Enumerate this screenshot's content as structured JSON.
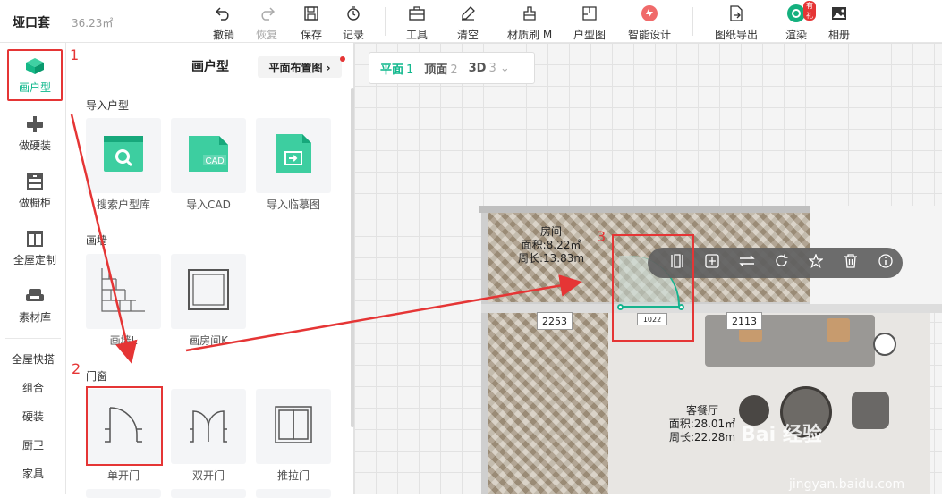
{
  "header": {
    "project_name": "垭口套",
    "project_area": "36.23㎡",
    "toolbar": [
      {
        "label": "撤销",
        "icon": "undo-icon"
      },
      {
        "label": "恢复",
        "icon": "redo-icon"
      },
      {
        "label": "保存",
        "icon": "save-icon"
      },
      {
        "label": "记录",
        "icon": "history-icon"
      },
      {
        "label": "工具",
        "icon": "toolbox-icon"
      },
      {
        "label": "清空",
        "icon": "eraser-icon"
      },
      {
        "label": "材质刷 M",
        "icon": "brush-icon"
      },
      {
        "label": "户型图",
        "icon": "floorplan-icon"
      },
      {
        "label": "智能设计",
        "icon": "ai-design-icon"
      },
      {
        "label": "图纸导出",
        "icon": "export-icon"
      },
      {
        "label": "渲染",
        "icon": "render-icon",
        "badge": "有礼"
      },
      {
        "label": "相册",
        "icon": "album-icon"
      }
    ]
  },
  "leftnav": {
    "items": [
      {
        "label": "画户型",
        "icon": "floorplan-cube-icon",
        "active": true
      },
      {
        "label": "做硬装",
        "icon": "paint-roller-icon"
      },
      {
        "label": "做橱柜",
        "icon": "cabinet-icon"
      },
      {
        "label": "全屋定制",
        "icon": "wardrobe-icon"
      },
      {
        "label": "素材库",
        "icon": "sofa-icon"
      }
    ],
    "text_items": [
      "全屋快搭",
      "组合",
      "硬装",
      "厨卫",
      "家具"
    ]
  },
  "panel": {
    "title": "画户型",
    "layout_button": "平面布置图 ›",
    "sections": {
      "import": {
        "title": "导入户型",
        "cards": [
          "搜索户型库",
          "导入CAD",
          "导入临摹图"
        ]
      },
      "wall": {
        "title": "画墙",
        "cards": [
          "画墙L",
          "画房间K"
        ]
      },
      "doors": {
        "title": "门窗",
        "cards": [
          "单开门",
          "双开门",
          "推拉门"
        ]
      }
    }
  },
  "canvas": {
    "view_tabs": [
      {
        "label": "平面",
        "num": "1",
        "active": true
      },
      {
        "label": "顶面",
        "num": "2"
      },
      {
        "label": "3D",
        "num": "3 ⌄"
      }
    ],
    "rooms": {
      "room1": {
        "name": "房间",
        "area": "面积:8.22㎡",
        "perimeter": "周长:13.83m"
      },
      "room2": {
        "name": "客餐厅",
        "area": "面积:28.01㎡",
        "perimeter": "周长:22.28m"
      }
    },
    "dimensions": {
      "left": "2253",
      "door": "1022",
      "right": "2113"
    },
    "annotations": [
      "1",
      "2",
      "3"
    ]
  },
  "watermark": {
    "logo": "Bai 经验",
    "url": "jingyan.baidu.com"
  },
  "colors": {
    "accent": "#11b88d",
    "annotation": "#e53535"
  }
}
